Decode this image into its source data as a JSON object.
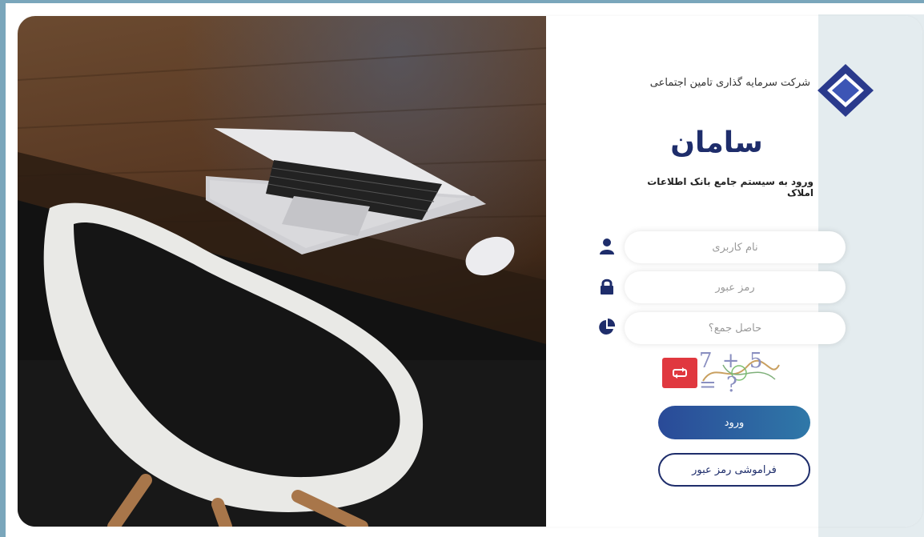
{
  "header": {
    "company_name": "شرکت سرمایه گذاری تامین اجتماعی",
    "brand": "سامان",
    "subtitle": "ورود به سیستم جامع بانک اطلاعات املاک"
  },
  "form": {
    "username_placeholder": "نام کاربری",
    "password_placeholder": "رمز عبور",
    "captcha_placeholder": "حاصل جمع؟",
    "captcha_expression": "7 + 5 = ?",
    "login_label": "ورود",
    "forgot_label": "فراموشی رمز عبور"
  },
  "icons": {
    "username": "user-icon",
    "password": "lock-icon",
    "captcha": "pie-chart-icon",
    "refresh": "refresh-icon",
    "logo": "diamond-logo"
  },
  "colors": {
    "brand_navy": "#1e2d6b",
    "accent_red": "#e0383f",
    "button_gradient_start": "#2a4a98",
    "button_gradient_end": "#2f78a8",
    "frame_border": "#7aa6bb",
    "side_band": "#e4ecef"
  }
}
